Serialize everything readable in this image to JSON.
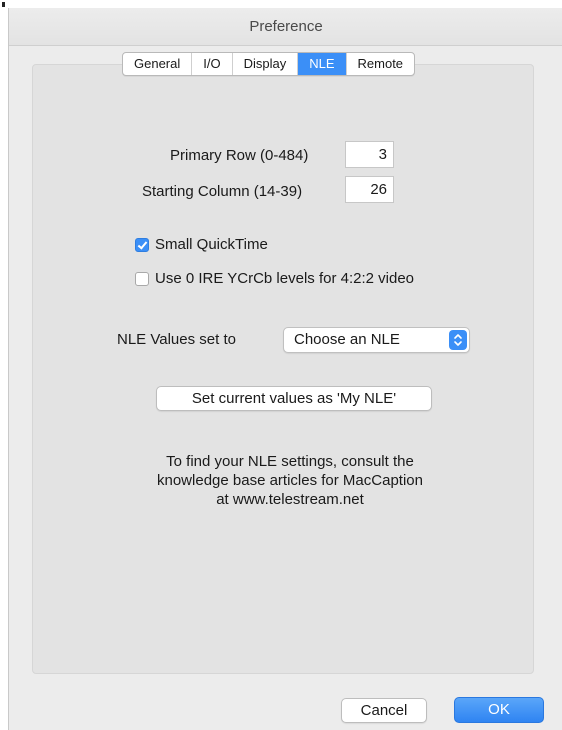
{
  "window": {
    "title": "Preference"
  },
  "tabs": [
    {
      "label": "General",
      "active": false
    },
    {
      "label": "I/O",
      "active": false
    },
    {
      "label": "Display",
      "active": false
    },
    {
      "label": "NLE",
      "active": true
    },
    {
      "label": "Remote",
      "active": false
    }
  ],
  "fields": {
    "primary_row": {
      "label": "Primary Row (0-484)",
      "value": "3"
    },
    "starting_column": {
      "label": "Starting Column (14-39)",
      "value": "26"
    }
  },
  "checkboxes": {
    "small_quicktime": {
      "label": "Small QuickTime",
      "checked": true
    },
    "zero_ire": {
      "label": "Use 0 IRE YCrCb levels for 4:2:2 video",
      "checked": false
    }
  },
  "nle_select": {
    "label": "NLE Values set to",
    "value": "Choose an NLE"
  },
  "set_button": {
    "label": "Set current values as 'My NLE'"
  },
  "info": {
    "line1": "To find your NLE settings, consult the",
    "line2": "knowledge base articles for MacCaption",
    "line3": "at www.telestream.net"
  },
  "footer": {
    "cancel_label": "Cancel",
    "ok_label": "OK"
  },
  "colors": {
    "accent": "#3b8ff7",
    "window_bg": "#ececec",
    "panel_bg": "#e3e3e3"
  }
}
